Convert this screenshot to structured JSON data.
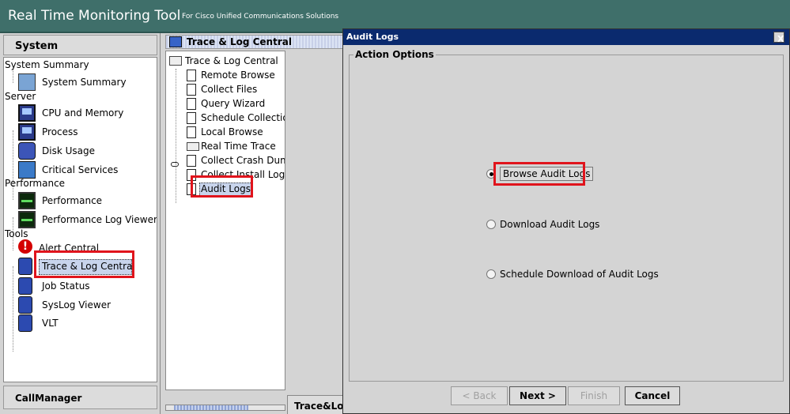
{
  "app": {
    "title": "Real Time Monitoring Tool",
    "subtitle": "For Cisco Unified Communications Solutions"
  },
  "left_panel": {
    "header": "System",
    "footer": "CallManager",
    "sections": [
      {
        "label": "System Summary",
        "items": [
          {
            "label": "System Summary",
            "icon": "system-summary-icon"
          }
        ]
      },
      {
        "label": "Server",
        "items": [
          {
            "label": "CPU and Memory",
            "icon": "monitor-icon"
          },
          {
            "label": "Process",
            "icon": "monitor-icon"
          },
          {
            "label": "Disk Usage",
            "icon": "disk-icon"
          },
          {
            "label": "Critical Services",
            "icon": "puzzle-icon"
          }
        ]
      },
      {
        "label": "Performance",
        "items": [
          {
            "label": "Performance",
            "icon": "performance-graph-icon"
          },
          {
            "label": "Performance Log Viewer",
            "icon": "performance-graph-icon"
          }
        ]
      },
      {
        "label": "Tools",
        "items": [
          {
            "label": "Alert Central",
            "icon": "alert-icon"
          },
          {
            "label": "Trace & Log Central",
            "icon": "database-icon"
          },
          {
            "label": "Job Status",
            "icon": "database-icon"
          },
          {
            "label": "SysLog Viewer",
            "icon": "database-icon"
          },
          {
            "label": "VLT",
            "icon": "database-icon"
          }
        ]
      }
    ]
  },
  "middle_panel": {
    "tab_title": "Trace & Log Central",
    "root": "Trace & Log Central",
    "items": [
      "Remote Browse",
      "Collect Files",
      "Query Wizard",
      "Schedule Collection",
      "Local Browse",
      "Real Time Trace",
      "Collect Crash Dump",
      "Collect Install Logs",
      "Audit Logs"
    ],
    "bottom_tab": "Trace&Log"
  },
  "dialog": {
    "title": "Audit Logs",
    "close": "X",
    "group_title": "Action Options",
    "options": [
      {
        "label": "Browse Audit Logs",
        "selected": true
      },
      {
        "label": "Download Audit Logs",
        "selected": false
      },
      {
        "label": "Schedule Download of Audit Logs",
        "selected": false
      }
    ],
    "buttons": {
      "back": "< Back",
      "next": "Next >",
      "finish": "Finish",
      "cancel": "Cancel"
    }
  },
  "colors": {
    "title_bar": "#3f6f6a",
    "dialog_title": "#0a2a6e",
    "highlight": "#e0141c",
    "selection": "#c8d4ec"
  }
}
